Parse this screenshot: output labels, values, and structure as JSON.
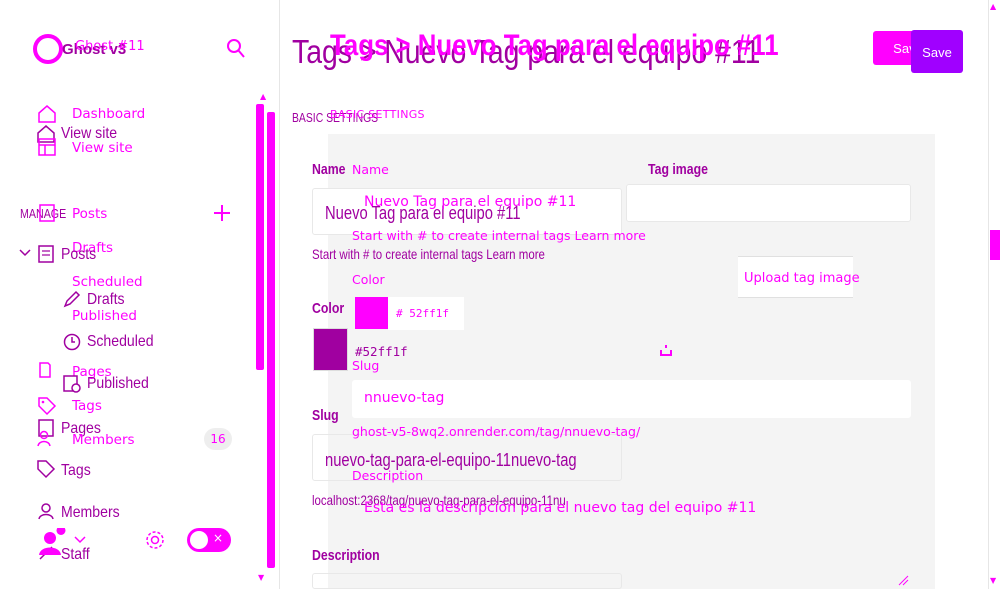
{
  "sidebar": {
    "brand_back": "Ghost v3",
    "brand_front": "Ghost #11",
    "nav_front": {
      "dashboard": "Dashboard",
      "view_site": "View site",
      "posts": "Posts",
      "drafts": "Drafts",
      "scheduled": "Scheduled",
      "published": "Published",
      "pages": "Pages",
      "tags": "Tags",
      "members": "Members",
      "members_count": "16"
    },
    "nav_back": {
      "view_site": "View site",
      "manage": "MANAGE",
      "posts": "Posts",
      "drafts": "Drafts",
      "scheduled": "Scheduled",
      "published": "Published",
      "pages": "Pages",
      "tags": "Tags",
      "members": "Members",
      "staff": "Staff"
    },
    "icons": [
      "home-icon",
      "browser-icon",
      "post-icon",
      "pen-icon",
      "clock-icon",
      "published-icon",
      "page-icon",
      "tag-icon",
      "members-icon",
      "staff-icon",
      "plus-icon",
      "gear-icon",
      "search-icon"
    ]
  },
  "header": {
    "title_back": "Tags  >  Nuevo Tag para el equipo #11",
    "title_front": "Tags > Nuevo Tag para el equipo #11",
    "save_back": "Save",
    "save_front": "Save"
  },
  "section": {
    "back": "BASIC SETTINGS",
    "front": "BASIC SETTINGS"
  },
  "form_back": {
    "name_label": "Name",
    "name_value": "Nuevo Tag para el equipo #11",
    "name_hint": "Start with # to create internal tags Learn more",
    "color_label": "Color",
    "color_value": "#52ff1f",
    "slug_label": "Slug",
    "slug_value": "nuevo-tag-para-el-equipo-11nuevo-tag",
    "slug_hint": "localhost:2368/tag/nuevo-tag-para-el-equipo-11nu",
    "description_label": "Description",
    "image_label": "Tag image"
  },
  "form_front": {
    "name_label": "Name",
    "name_value": "Nuevo Tag para el equipo #11",
    "name_hint": "Start with # to create internal tags Learn more",
    "color_label": "Color",
    "color_value": "# 52ff1f",
    "slug_label": "Slug",
    "slug_value": "nnuevo-tag",
    "slug_hint": "ghost-v5-8wq2.onrender.com/tag/nnuevo-tag/",
    "description_label": "Description",
    "description_value": "Esta es la descripción para el nuevo tag del equipo #11",
    "upload_label": "Upload tag image"
  },
  "colors": {
    "accent": "#ff00ff",
    "accent_dark": "#a000a0",
    "save_front_bg": "#a000ff",
    "panel_bg": "#f4f4f4"
  }
}
